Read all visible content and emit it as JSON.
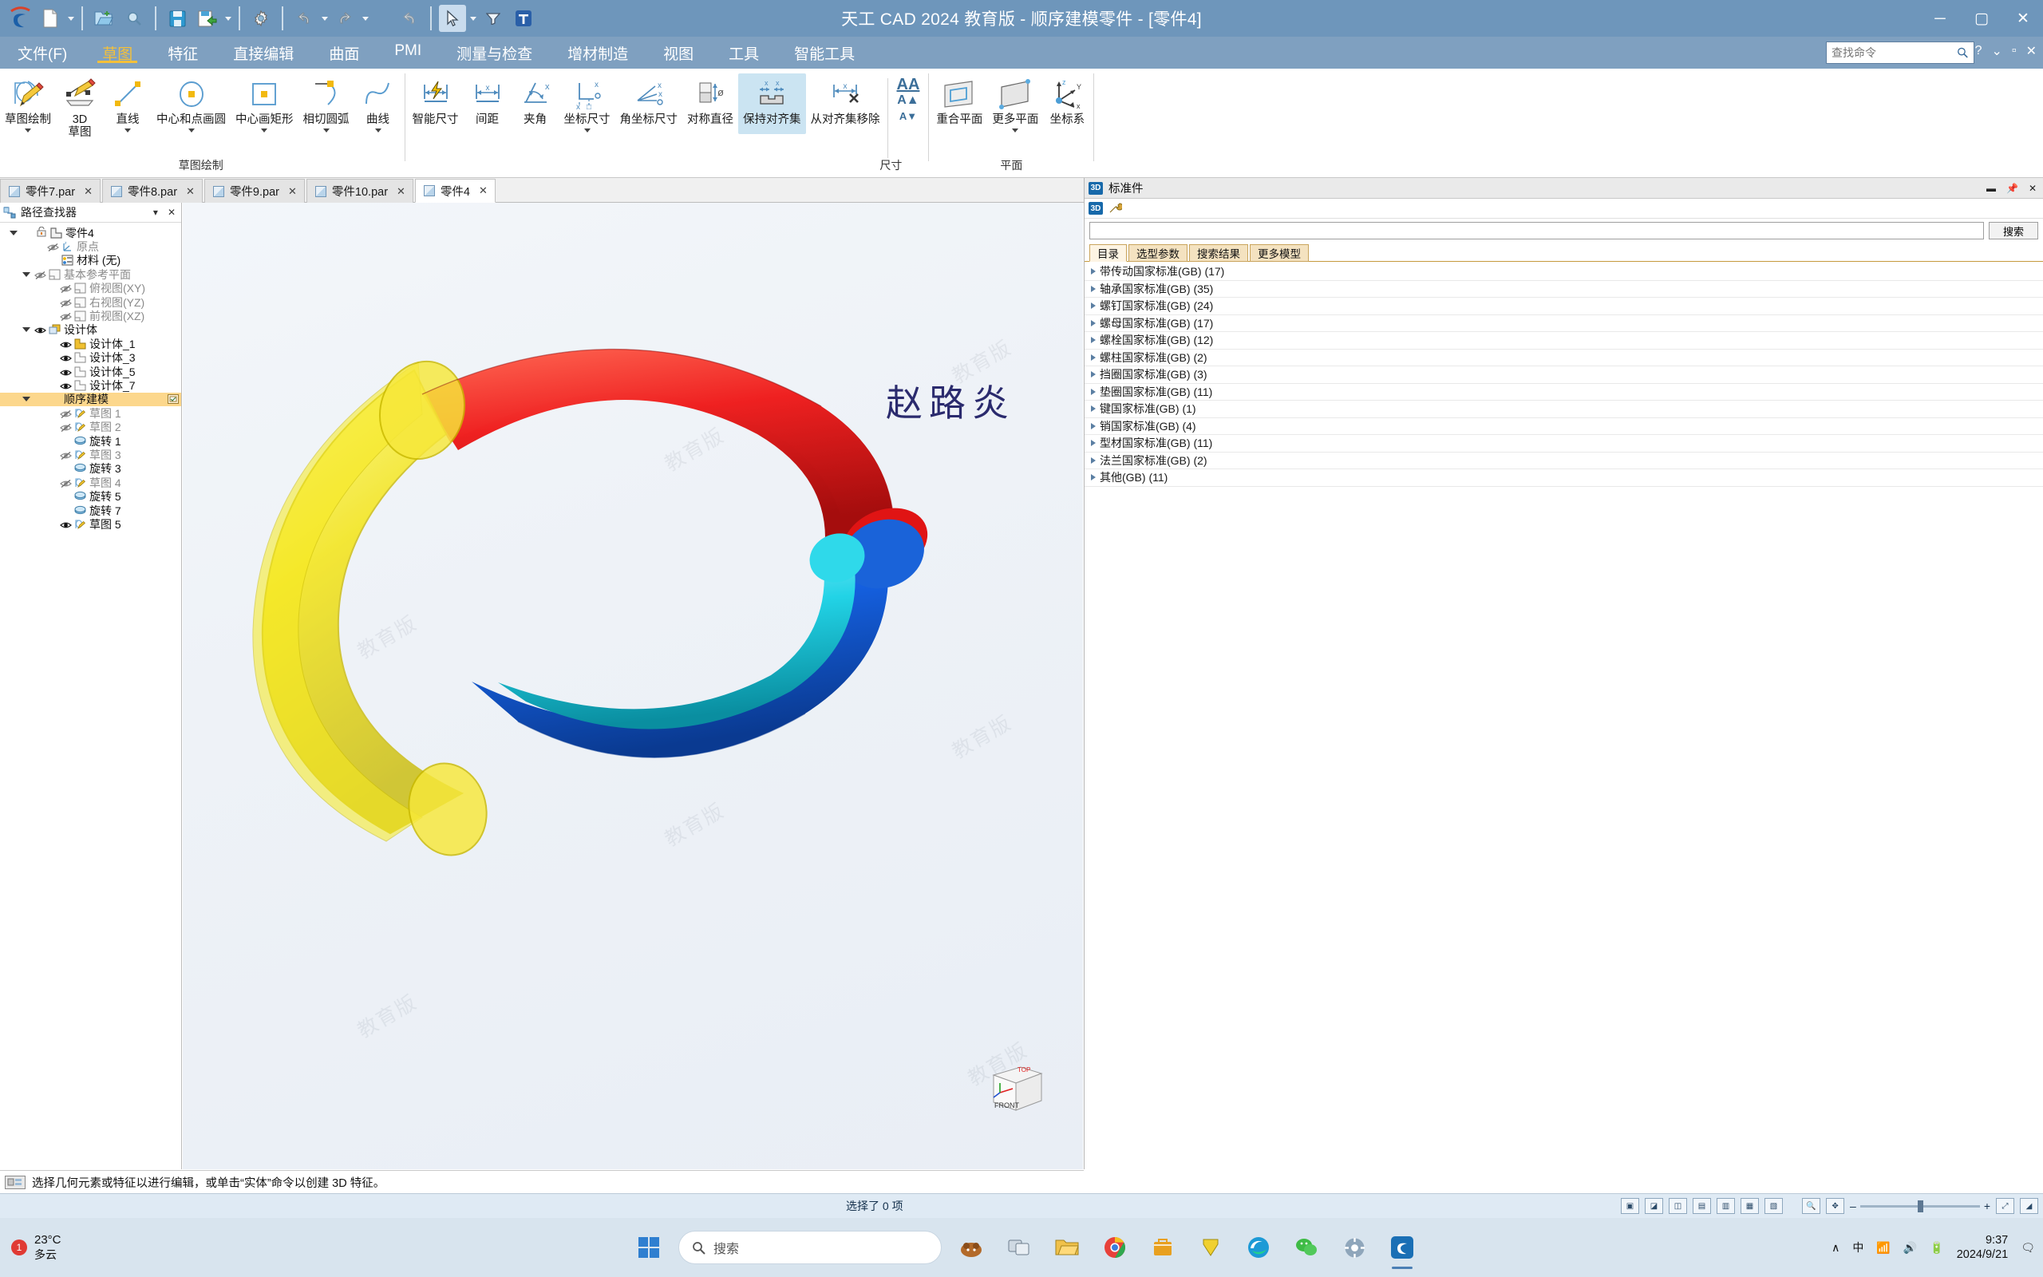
{
  "titlebar": {
    "title": "天工 CAD 2024 教育版 - 顺序建模零件 - [零件4]",
    "quick_access": [
      {
        "name": "new-file",
        "icon": "document"
      },
      {
        "name": "open-file",
        "icon": "folder-open"
      },
      {
        "name": "open-search",
        "icon": "magnifier"
      },
      {
        "name": "save",
        "icon": "floppy"
      },
      {
        "name": "save-as",
        "icon": "floppy-export"
      },
      {
        "name": "settings",
        "icon": "gear"
      },
      {
        "name": "undo",
        "icon": "undo-arrow"
      },
      {
        "name": "redo",
        "icon": "redo-arrow"
      },
      {
        "name": "undo-all",
        "icon": "undo-arrow"
      },
      {
        "name": "select-tool",
        "icon": "cursor"
      },
      {
        "name": "text-tool",
        "icon": "text-T"
      }
    ],
    "window_buttons": {
      "minimize": "─",
      "maximize": "▢",
      "close": "✕"
    }
  },
  "menubar": {
    "items": [
      "文件(F)",
      "草图",
      "特征",
      "直接编辑",
      "曲面",
      "PMI",
      "测量与检查",
      "增材制造",
      "视图",
      "工具",
      "智能工具"
    ],
    "active": "草图",
    "search_placeholder": "查找命令",
    "search_value": "",
    "right_icons": [
      "?",
      "⌄",
      "▫",
      "✕"
    ]
  },
  "ribbon": {
    "groups": [
      {
        "title": "草图绘制",
        "buttons": [
          {
            "label": "草图绘制",
            "icon": "sketch-draw-icon",
            "dropdown": true,
            "active": false
          },
          {
            "label": "3D\n草图",
            "icon": "sketch-3d-icon",
            "dropdown": false,
            "active": false
          },
          {
            "label": "直线",
            "icon": "line-icon",
            "dropdown": true,
            "active": false
          },
          {
            "label": "中心和点画圆",
            "icon": "circle-center-point-icon",
            "dropdown": true,
            "active": false
          },
          {
            "label": "中心画矩形",
            "icon": "rectangle-center-icon",
            "dropdown": true,
            "active": false
          },
          {
            "label": "相切圆弧",
            "icon": "tangent-arc-icon",
            "dropdown": true,
            "active": false
          },
          {
            "label": "曲线",
            "icon": "curve-icon",
            "dropdown": true,
            "active": false
          }
        ]
      },
      {
        "title": "尺寸",
        "buttons": [
          {
            "label": "智能尺寸",
            "icon": "smart-dimension-icon",
            "dropdown": false,
            "active": false
          },
          {
            "label": "间距",
            "icon": "distance-icon",
            "dropdown": false,
            "active": false
          },
          {
            "label": "夹角",
            "icon": "angle-icon",
            "dropdown": false,
            "active": false
          },
          {
            "label": "坐标尺寸",
            "icon": "coordinate-dimension-icon",
            "dropdown": true,
            "active": false
          },
          {
            "label": "角坐标尺寸",
            "icon": "angular-coordinate-icon",
            "dropdown": false,
            "active": false
          },
          {
            "label": "对称直径",
            "icon": "symmetric-diameter-icon",
            "dropdown": false,
            "active": false
          },
          {
            "label": "保持对齐集",
            "icon": "keep-align-set-icon",
            "dropdown": false,
            "active": true
          },
          {
            "label": "从对齐集移除",
            "icon": "remove-from-align-set-icon",
            "dropdown": false,
            "active": false
          }
        ],
        "text_stack": [
          "AA",
          "A▲",
          "A▼"
        ]
      },
      {
        "title": "平面",
        "buttons": [
          {
            "label": "重合平面",
            "icon": "coincident-plane-icon",
            "dropdown": false,
            "active": false
          },
          {
            "label": "更多平面",
            "icon": "more-planes-icon",
            "dropdown": true,
            "active": false
          },
          {
            "label": "坐标系",
            "icon": "coordinate-system-icon",
            "dropdown": false,
            "active": false
          }
        ]
      }
    ]
  },
  "doc_tabs": {
    "tabs": [
      {
        "label": "零件7.par",
        "active": false
      },
      {
        "label": "零件8.par",
        "active": false
      },
      {
        "label": "零件9.par",
        "active": false
      },
      {
        "label": "零件10.par",
        "active": false
      },
      {
        "label": "零件4",
        "active": true
      }
    ],
    "nav": [
      "◁",
      "▷",
      "▾",
      "✕"
    ]
  },
  "left_panel": {
    "title": "路径查找器",
    "buttons": [
      "▾",
      "✕"
    ],
    "tree": [
      {
        "label": "零件4",
        "indent": 0,
        "expander": true,
        "eye": "none",
        "icon": "part-icon",
        "dim": false,
        "highlight": false,
        "lock": true
      },
      {
        "label": "原点",
        "indent": 2,
        "expander": false,
        "eye": "hidden",
        "icon": "origin-icon",
        "dim": true,
        "highlight": false
      },
      {
        "label": "材料 (无)",
        "indent": 2,
        "expander": false,
        "eye": "none",
        "icon": "material-icon",
        "dim": false,
        "highlight": false
      },
      {
        "label": "基本参考平面",
        "indent": 1,
        "expander": true,
        "eye": "hidden",
        "icon": "plane-icon",
        "dim": true,
        "highlight": false
      },
      {
        "label": "俯视图(XY)",
        "indent": 3,
        "expander": false,
        "eye": "hidden",
        "icon": "plane-icon",
        "dim": true,
        "highlight": false
      },
      {
        "label": "右视图(YZ)",
        "indent": 3,
        "expander": false,
        "eye": "hidden",
        "icon": "plane-icon",
        "dim": true,
        "highlight": false
      },
      {
        "label": "前视图(XZ)",
        "indent": 3,
        "expander": false,
        "eye": "hidden",
        "icon": "plane-icon",
        "dim": true,
        "highlight": false
      },
      {
        "label": "设计体",
        "indent": 1,
        "expander": true,
        "eye": "visible",
        "icon": "body-group-icon",
        "dim": false,
        "highlight": false
      },
      {
        "label": "设计体_1",
        "indent": 3,
        "expander": false,
        "eye": "visible",
        "icon": "body-yellow-icon",
        "dim": false,
        "highlight": false
      },
      {
        "label": "设计体_3",
        "indent": 3,
        "expander": false,
        "eye": "visible",
        "icon": "body-white-icon",
        "dim": false,
        "highlight": false
      },
      {
        "label": "设计体_5",
        "indent": 3,
        "expander": false,
        "eye": "visible",
        "icon": "body-white-icon",
        "dim": false,
        "highlight": false
      },
      {
        "label": "设计体_7",
        "indent": 3,
        "expander": false,
        "eye": "visible",
        "icon": "body-white-icon",
        "dim": false,
        "highlight": false
      },
      {
        "label": "顺序建模",
        "indent": 1,
        "expander": true,
        "eye": "none",
        "icon": "none",
        "dim": false,
        "highlight": true
      },
      {
        "label": "草图 1",
        "indent": 3,
        "expander": false,
        "eye": "hidden",
        "icon": "sketch-icon",
        "dim": true,
        "highlight": false
      },
      {
        "label": "草图 2",
        "indent": 3,
        "expander": false,
        "eye": "hidden",
        "icon": "sketch-icon",
        "dim": true,
        "highlight": false
      },
      {
        "label": "旋转 1",
        "indent": 3,
        "expander": false,
        "eye": "none",
        "icon": "revolve-icon",
        "dim": false,
        "highlight": false
      },
      {
        "label": "草图 3",
        "indent": 3,
        "expander": false,
        "eye": "hidden",
        "icon": "sketch-icon",
        "dim": true,
        "highlight": false
      },
      {
        "label": "旋转 3",
        "indent": 3,
        "expander": false,
        "eye": "none",
        "icon": "revolve-icon",
        "dim": false,
        "highlight": false
      },
      {
        "label": "草图 4",
        "indent": 3,
        "expander": false,
        "eye": "hidden",
        "icon": "sketch-icon",
        "dim": true,
        "highlight": false
      },
      {
        "label": "旋转 5",
        "indent": 3,
        "expander": false,
        "eye": "none",
        "icon": "revolve-icon",
        "dim": false,
        "highlight": false
      },
      {
        "label": "旋转 7",
        "indent": 3,
        "expander": false,
        "eye": "none",
        "icon": "revolve-icon",
        "dim": false,
        "highlight": false
      },
      {
        "label": "草图 5",
        "indent": 3,
        "expander": false,
        "eye": "visible",
        "icon": "sketch-icon",
        "dim": false,
        "highlight": false
      }
    ]
  },
  "canvas": {
    "signature": "赵路炎",
    "watermark": "教育版",
    "model_colors": {
      "red": "#ef2121",
      "yellow": "#f5e400",
      "blue": "#1560e0",
      "cyan": "#22d3e6"
    },
    "viewcube": {
      "top": "TOP",
      "front": "FRONT"
    }
  },
  "right_panel": {
    "title": "标准件",
    "header_buttons": [
      "▬",
      "📌",
      "✕"
    ],
    "search_value": "",
    "search_button": "搜索",
    "tabs": [
      {
        "label": "目录",
        "active": true
      },
      {
        "label": "选型参数",
        "active": false
      },
      {
        "label": "搜索结果",
        "active": false
      },
      {
        "label": "更多模型",
        "active": false
      }
    ],
    "items": [
      {
        "label": "带传动国家标准(GB)",
        "count": "(17)"
      },
      {
        "label": "轴承国家标准(GB)",
        "count": "(35)"
      },
      {
        "label": "螺钉国家标准(GB)",
        "count": "(24)"
      },
      {
        "label": "螺母国家标准(GB)",
        "count": "(17)"
      },
      {
        "label": "螺栓国家标准(GB)",
        "count": "(12)"
      },
      {
        "label": "螺柱国家标准(GB)",
        "count": "(2)"
      },
      {
        "label": "挡圈国家标准(GB)",
        "count": "(3)"
      },
      {
        "label": "垫圈国家标准(GB)",
        "count": "(11)"
      },
      {
        "label": "键国家标准(GB)",
        "count": "(1)"
      },
      {
        "label": "销国家标准(GB)",
        "count": "(4)"
      },
      {
        "label": "型材国家标准(GB)",
        "count": "(11)"
      },
      {
        "label": "法兰国家标准(GB)",
        "count": "(2)"
      },
      {
        "label": "其他(GB)",
        "count": "(11)"
      }
    ]
  },
  "prompt_bar": {
    "text": "选择几何元素或特征以进行编辑，或单击“实体”命令以创建 3D 特征。"
  },
  "status_bar": {
    "selection": "选择了 0 项",
    "zoom_percent": ""
  },
  "taskbar": {
    "weather_temp": "23°C",
    "weather_desc": "多云",
    "weather_badge": "1",
    "search_placeholder": "搜索",
    "clock_time": "9:37",
    "clock_date": "2024/9/21",
    "tray": [
      "∧",
      "中",
      "🔊",
      "🔋"
    ],
    "apps": [
      {
        "name": "start-button",
        "icon": "windows"
      },
      {
        "name": "search-box",
        "icon": "search"
      },
      {
        "name": "copilot",
        "icon": "copilot"
      },
      {
        "name": "task-view",
        "icon": "taskview"
      },
      {
        "name": "file-explorer",
        "icon": "explorer"
      },
      {
        "name": "chrome",
        "icon": "chrome"
      },
      {
        "name": "store",
        "icon": "store"
      },
      {
        "name": "app-yellow",
        "icon": "app"
      },
      {
        "name": "edge",
        "icon": "edge"
      },
      {
        "name": "wechat",
        "icon": "wechat"
      },
      {
        "name": "settings",
        "icon": "settings"
      },
      {
        "name": "tiangong-cad",
        "icon": "cad"
      }
    ]
  }
}
